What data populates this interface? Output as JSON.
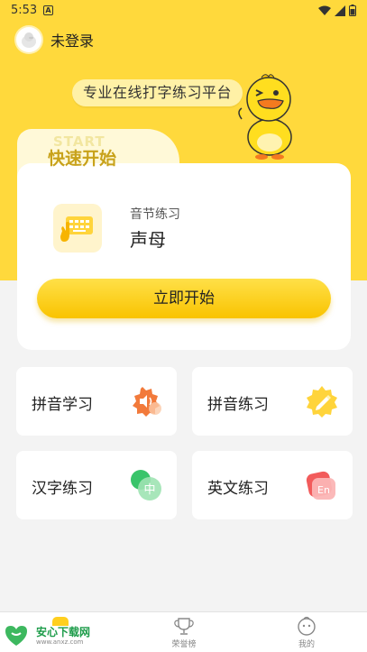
{
  "status_bar": {
    "time": "5:53",
    "notif_glyph": "A"
  },
  "user": {
    "name": "未登录",
    "avatar_icon": "duck-avatar-icon"
  },
  "header": {
    "slogan": "专业在线打字练习平台"
  },
  "quick_start": {
    "ghost_text": "START",
    "title": "快速开始",
    "lesson_category": "音节练习",
    "lesson_name": "声母",
    "start_button": "立即开始"
  },
  "tiles": [
    {
      "label": "拼音学习",
      "icon": "speaker-badge-icon",
      "color": "#f27a3b"
    },
    {
      "label": "拼音练习",
      "icon": "pencil-badge-icon",
      "color": "#ffd43b"
    },
    {
      "label": "汉字练习",
      "icon": "chinese-char-icon",
      "color": "#39c46a",
      "glyph": "中"
    },
    {
      "label": "英文练习",
      "icon": "english-badge-icon",
      "color": "#f25b5b",
      "glyph": "En"
    }
  ],
  "nav": [
    {
      "label": "",
      "icon": "home-icon",
      "active": true
    },
    {
      "label": "荣誉榜",
      "icon": "trophy-icon",
      "active": false
    },
    {
      "label": "我的",
      "icon": "profile-icon",
      "active": false
    }
  ],
  "watermark": {
    "title": "安心下载网",
    "url": "www.anxz.com"
  },
  "colors": {
    "brand_yellow": "#ffd93c",
    "accent_gold": "#c8a21a"
  }
}
